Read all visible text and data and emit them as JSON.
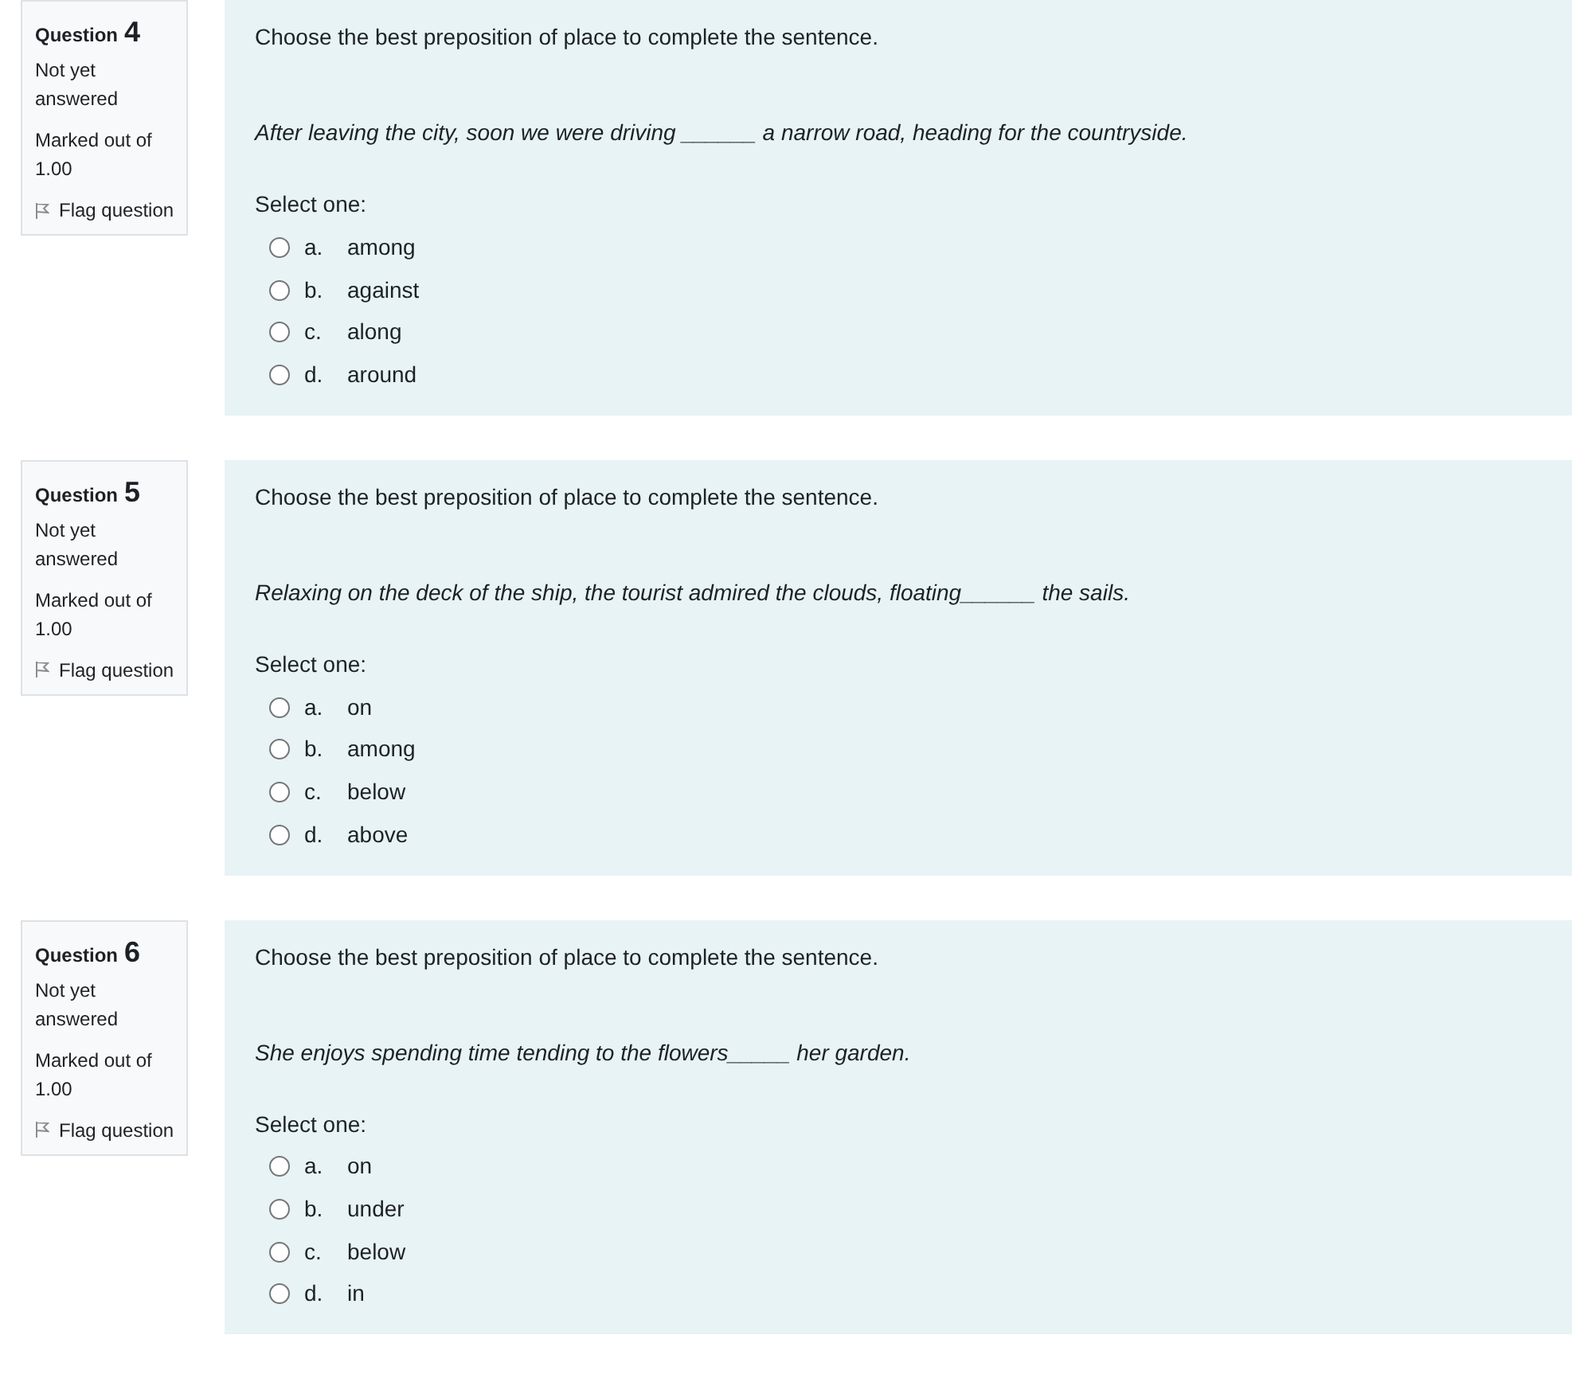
{
  "questions": [
    {
      "label": "Question",
      "number": "4",
      "status": "Not yet answered",
      "marks_label": "Marked out of",
      "marks_value": "1.00",
      "flag_label": "Flag question",
      "flagged": false,
      "prompt": "Choose the best preposition of place to complete the sentence.",
      "sentence": "After leaving the city, soon we were driving ______ a narrow road, heading for the countryside.",
      "select_label": "Select one:",
      "options": [
        {
          "letter": "a.",
          "text": "among",
          "selected": false
        },
        {
          "letter": "b.",
          "text": "against",
          "selected": false
        },
        {
          "letter": "c.",
          "text": "along",
          "selected": false
        },
        {
          "letter": "d.",
          "text": "around",
          "selected": false
        }
      ]
    },
    {
      "label": "Question",
      "number": "5",
      "status": "Not yet answered",
      "marks_label": "Marked out of",
      "marks_value": "1.00",
      "flag_label": "Flag question",
      "flagged": false,
      "prompt": "Choose the best preposition of place to complete the sentence.",
      "sentence": "Relaxing on the deck of the ship, the tourist admired the clouds, floating______ the sails.",
      "select_label": "Select one:",
      "options": [
        {
          "letter": "a.",
          "text": "on",
          "selected": false
        },
        {
          "letter": "b.",
          "text": "among",
          "selected": false
        },
        {
          "letter": "c.",
          "text": "below",
          "selected": false
        },
        {
          "letter": "d.",
          "text": "above",
          "selected": false
        }
      ]
    },
    {
      "label": "Question",
      "number": "6",
      "status": "Not yet answered",
      "marks_label": "Marked out of",
      "marks_value": "1.00",
      "flag_label": "Flag question",
      "flagged": false,
      "prompt": "Choose the best preposition of place to complete the sentence.",
      "sentence": "She enjoys spending time tending to the flowers_____ her garden.",
      "select_label": "Select one:",
      "options": [
        {
          "letter": "a.",
          "text": "on",
          "selected": false
        },
        {
          "letter": "b.",
          "text": "under",
          "selected": false
        },
        {
          "letter": "c.",
          "text": "below",
          "selected": false
        },
        {
          "letter": "d.",
          "text": "in",
          "selected": false
        }
      ]
    }
  ]
}
